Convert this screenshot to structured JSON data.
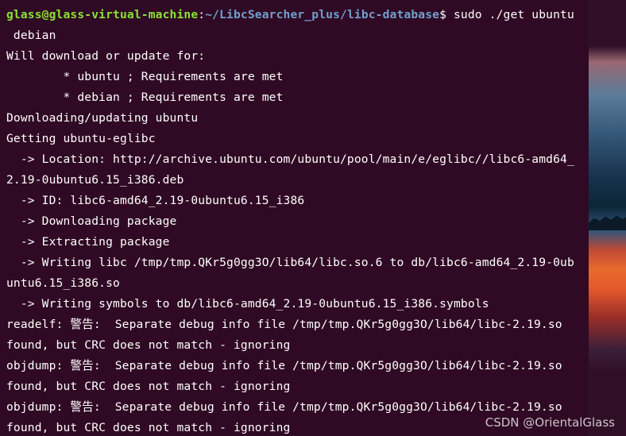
{
  "terminal": {
    "prompt_user_host": "glass@glass-virtual-machine",
    "prompt_sep": ":",
    "prompt_path": "~/LibcSearcher_plus/libc-database",
    "prompt_symbol": "$",
    "command": " sudo ./get ubuntu",
    "lines": [
      " debian",
      "Will download or update for:",
      "        * ubuntu ; Requirements are met",
      "        * debian ; Requirements are met",
      "Downloading/updating ubuntu",
      "Getting ubuntu-eglibc",
      "  -> Location: http://archive.ubuntu.com/ubuntu/pool/main/e/eglibc//libc6-amd64_",
      "2.19-0ubuntu6.15_i386.deb",
      "  -> ID: libc6-amd64_2.19-0ubuntu6.15_i386",
      "  -> Downloading package",
      "  -> Extracting package",
      "  -> Writing libc /tmp/tmp.QKr5g0gg3O/lib64/libc.so.6 to db/libc6-amd64_2.19-0ub",
      "untu6.15_i386.so",
      "  -> Writing symbols to db/libc6-amd64_2.19-0ubuntu6.15_i386.symbols",
      "readelf: 警告:  Separate debug info file /tmp/tmp.QKr5g0gg3O/lib64/libc-2.19.so",
      "found, but CRC does not match - ignoring",
      "objdump: 警告:  Separate debug info file /tmp/tmp.QKr5g0gg3O/lib64/libc-2.19.so",
      "found, but CRC does not match - ignoring",
      "objdump: 警告:  Separate debug info file /tmp/tmp.QKr5g0gg3O/lib64/libc-2.19.so",
      "found, but CRC does not match - ignoring"
    ]
  },
  "watermark": "CSDN @OrientalGlass",
  "colors": {
    "background": "#300a24",
    "user_host": "#8ae234",
    "path": "#729fcf",
    "text": "#ffffff"
  }
}
